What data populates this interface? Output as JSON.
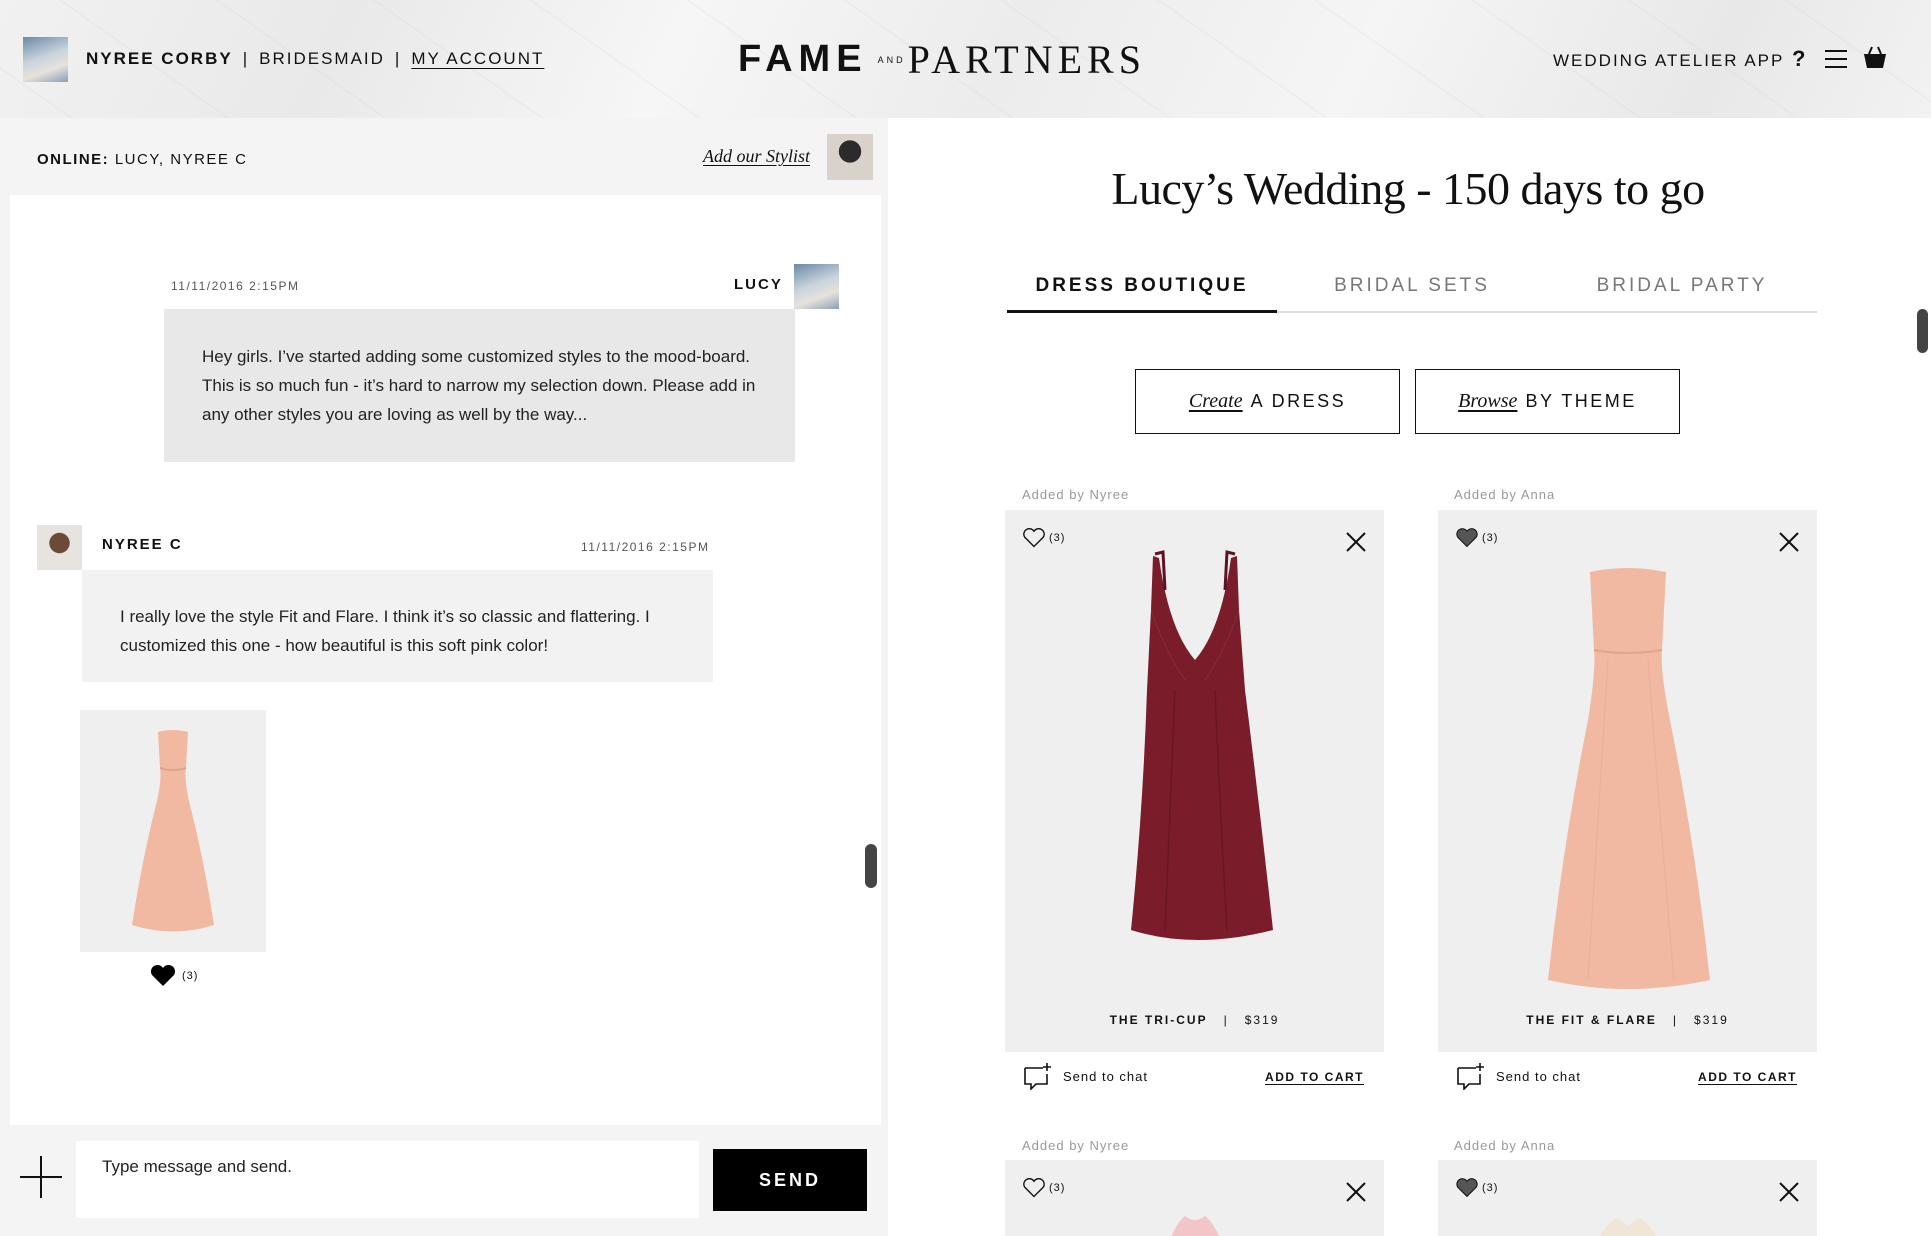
{
  "header": {
    "user_name": "NYREE CORBY",
    "separator": "|",
    "role": "BRIDESMAID",
    "account_link": "MY ACCOUNT",
    "logo_fame": "FAME",
    "logo_and": "AND",
    "logo_partners": "PARTNERS",
    "app_link": "WEDDING ATELIER APP",
    "help": "?"
  },
  "chat": {
    "online_label": "ONLINE:",
    "online_users": "LUCY, NYREE C",
    "add_stylist": "Add our Stylist",
    "messages": [
      {
        "time": "11/11/2016 2:15PM",
        "author": "LUCY",
        "text": "Hey girls. I’ve started adding some customized styles to the mood-board. This is so much fun - it’s hard to narrow my selection down. Please add in any other styles you are loving as well by the way..."
      },
      {
        "time": "11/11/2016 2:15PM",
        "author": "NYREE C",
        "text": "I really love the style Fit and Flare. I think it’s so classic and flattering. I customized this one - how beautiful is this soft pink color!"
      }
    ],
    "attachment_likes": "(3)",
    "input_placeholder": "Type message and send.",
    "send_label": "SEND"
  },
  "main": {
    "title": "Lucy’s Wedding - 150 days to go",
    "tabs": [
      {
        "label": "DRESS BOUTIQUE",
        "active": true
      },
      {
        "label": "BRIDAL SETS",
        "active": false
      },
      {
        "label": "BRIDAL PARTY",
        "active": false
      }
    ],
    "create_script": "Create",
    "create_label": "A DRESS",
    "browse_script": "Browse",
    "browse_label": "BY THEME",
    "cards": [
      {
        "added_by": "Added by Nyree",
        "likes": "(3)",
        "name": "THE TRI-CUP",
        "price": "$319",
        "color": "#7a1c2a",
        "send": "Send to chat",
        "cart": "ADD TO CART"
      },
      {
        "added_by": "Added by Anna",
        "likes": "(3)",
        "name": "THE FIT & FLARE",
        "price": "$319",
        "color": "#f2b9a2",
        "send": "Send to chat",
        "cart": "ADD TO CART"
      },
      {
        "added_by": "Added by Nyree",
        "likes": "(3)"
      },
      {
        "added_by": "Added by Anna",
        "likes": "(3)"
      }
    ]
  }
}
